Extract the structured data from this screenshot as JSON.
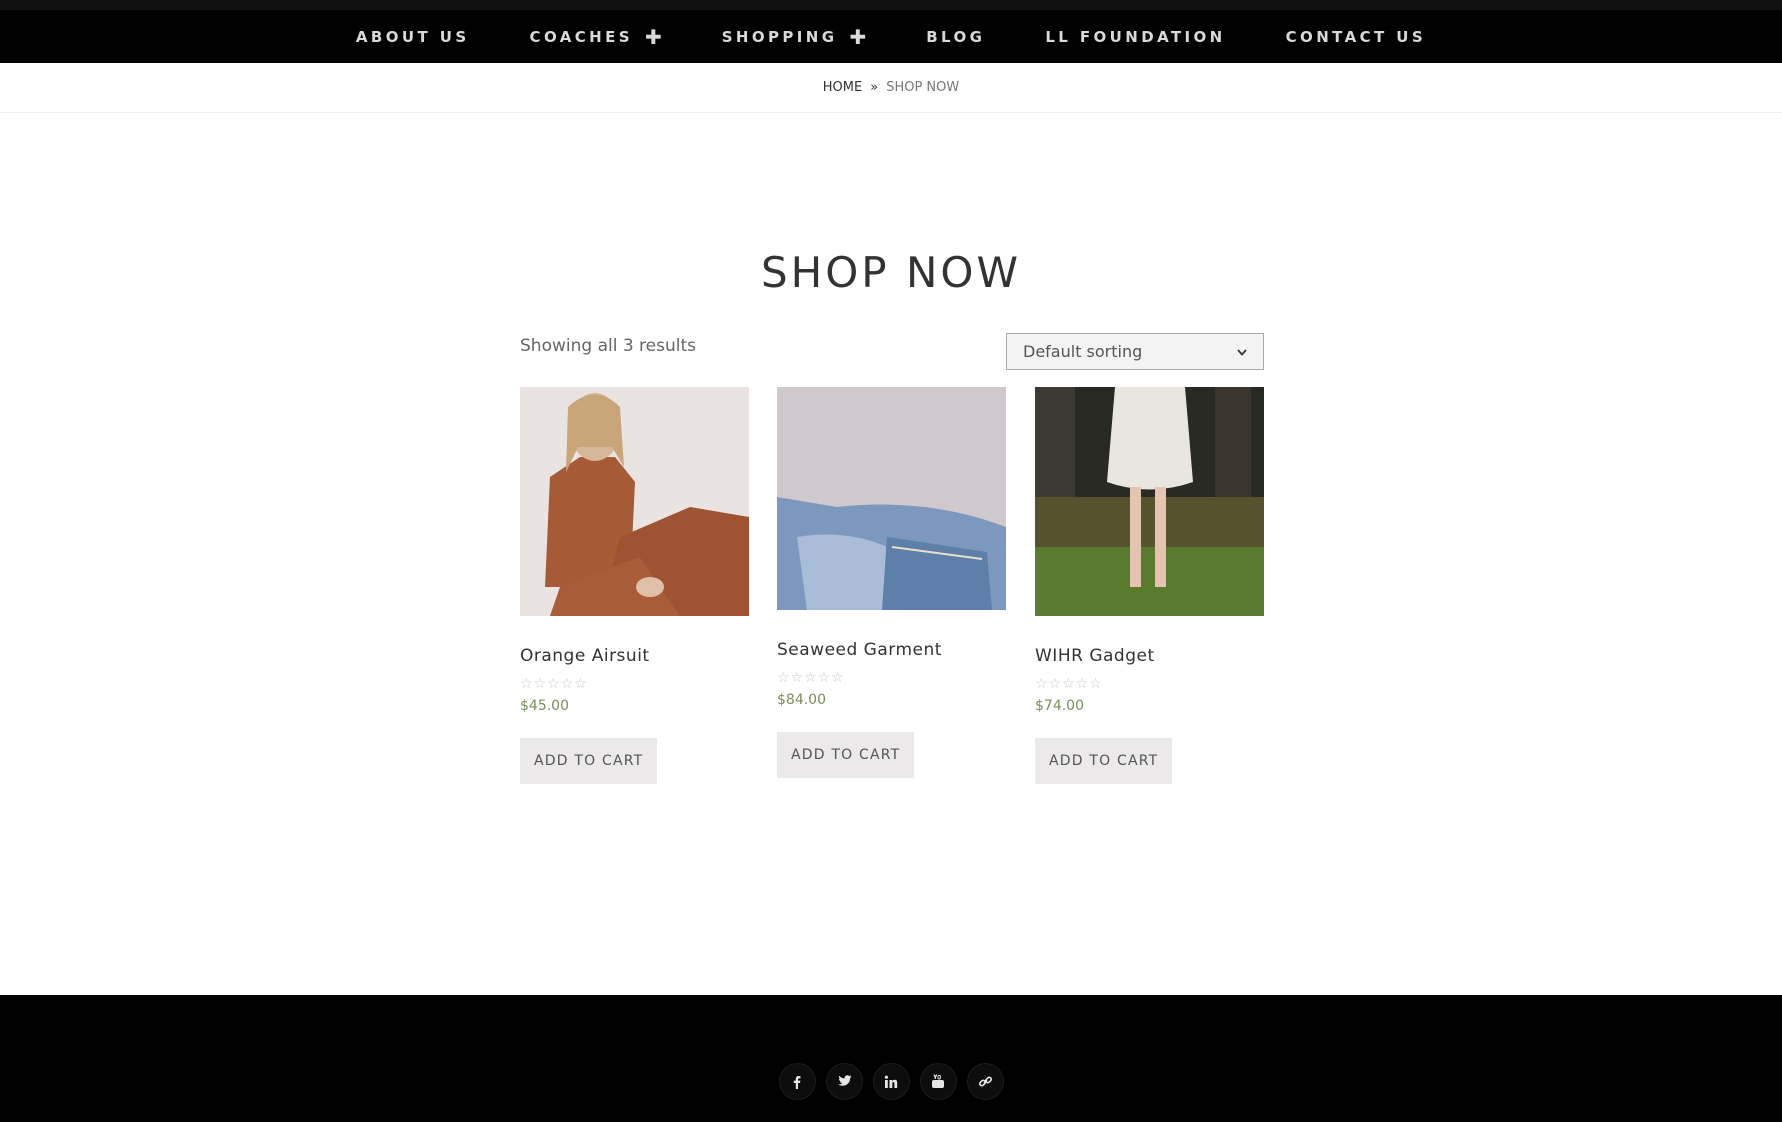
{
  "nav": {
    "items": [
      {
        "label": "ABOUT US",
        "has_submenu": false
      },
      {
        "label": "COACHES",
        "has_submenu": true
      },
      {
        "label": "SHOPPING",
        "has_submenu": true
      },
      {
        "label": "BLOG",
        "has_submenu": false
      },
      {
        "label": "LL FOUNDATION",
        "has_submenu": false
      },
      {
        "label": "CONTACT US",
        "has_submenu": false
      }
    ],
    "submenu_glyph": "✚"
  },
  "breadcrumb": {
    "home": "HOME",
    "separator": "»",
    "current": "SHOP NOW"
  },
  "page": {
    "title": "SHOP NOW",
    "result_count": "Showing all 3 results",
    "sorting": {
      "selected": "Default sorting"
    }
  },
  "products": [
    {
      "name": "Orange Airsuit",
      "rating": "☆☆☆☆☆",
      "price": "$45.00",
      "button": "ADD TO CART"
    },
    {
      "name": "Seaweed Garment",
      "rating": "☆☆☆☆☆",
      "price": "$84.00",
      "button": "ADD TO CART"
    },
    {
      "name": "WIHR Gadget",
      "rating": "☆☆☆☆☆",
      "price": "$74.00",
      "button": "ADD TO CART"
    }
  ],
  "footer": {
    "social": [
      "facebook-icon",
      "twitter-icon",
      "linkedin-icon",
      "youtube-icon",
      "link-icon"
    ]
  },
  "colors": {
    "nav_bg": "#000000",
    "price": "#7a8f5a",
    "button_bg": "#ebe9ea"
  }
}
